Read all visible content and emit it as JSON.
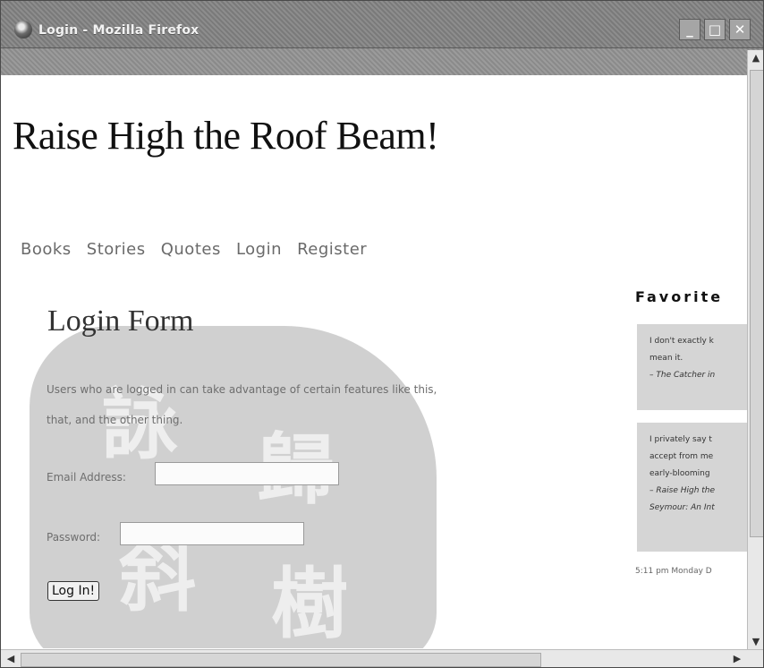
{
  "window": {
    "title": "Login - Mozilla Firefox",
    "controls": {
      "minimize": "_",
      "maximize": "□",
      "close": "✕"
    }
  },
  "site": {
    "title": "Raise High the Roof Beam!"
  },
  "nav": {
    "items": [
      "Books",
      "Stories",
      "Quotes",
      "Login",
      "Register"
    ]
  },
  "login_form": {
    "heading": "Login Form",
    "intro_line1": "Users who are logged in can take advantage of certain features like this,",
    "intro_line2": "that, and the other thing.",
    "email_label": "Email Address:",
    "email_value": "",
    "password_label": "Password:",
    "password_value": "",
    "submit_label": "Log In!"
  },
  "sidebar": {
    "heading": "Favorite",
    "quotes": [
      {
        "line1": "I don't exactly k",
        "line2": "mean it.",
        "attribution": "– The Catcher in"
      },
      {
        "line1": "I privately say t",
        "line2": "accept from me",
        "line3": "early-blooming",
        "attribution1": "– Raise High the",
        "attribution2": "Seymour: An Int"
      }
    ],
    "timestamp": "5:11 pm Monday D"
  },
  "scrollbars": {
    "up": "▲",
    "down": "▼",
    "left": "◀",
    "right": "▶"
  },
  "colors": {
    "titlebar": "#8a8a8a",
    "quote_box": "#d5d5d5",
    "seal": "#c8c8c8"
  },
  "icons": [
    "firefox-logo-icon",
    "minimize-icon",
    "maximize-icon",
    "close-icon"
  ],
  "watermark": {
    "glyphs": [
      "詠",
      "歸",
      "斜",
      "樹"
    ]
  }
}
